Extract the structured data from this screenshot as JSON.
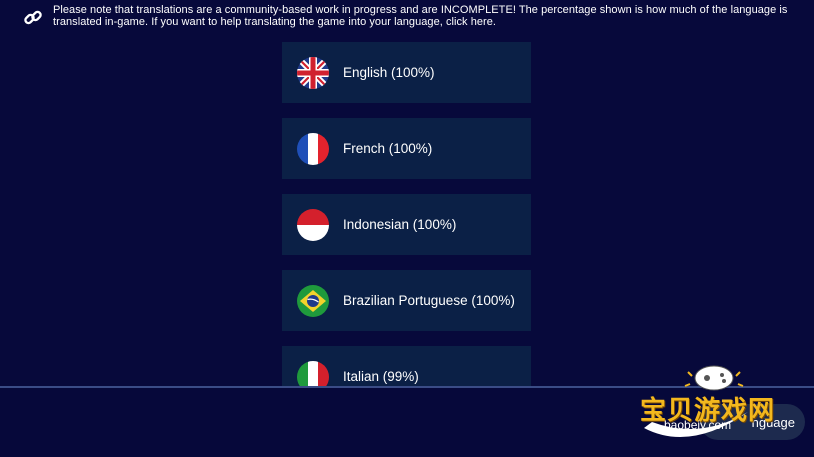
{
  "notice": {
    "text": "Please note that translations are a community-based work in progress and are INCOMPLETE! The percentage shown is how much of the language is translated in-game. If you want to help translating the game into your language, click here.",
    "icon": "link-icon"
  },
  "languages": [
    {
      "label": "English (100%)",
      "flag": "uk-flag-icon"
    },
    {
      "label": "French (100%)",
      "flag": "france-flag-icon"
    },
    {
      "label": "Indonesian (100%)",
      "flag": "indonesia-flag-icon"
    },
    {
      "label": "Brazilian Portuguese (100%)",
      "flag": "brazil-flag-icon"
    },
    {
      "label": "Italian (99%)",
      "flag": "italy-flag-icon"
    }
  ],
  "bottom": {
    "language_button_label": "nguage"
  },
  "watermark": {
    "cn": "宝贝游戏网",
    "en": "baobeiy.com"
  },
  "colors": {
    "background": "#07093b",
    "item_bg": "#0b2046",
    "divider": "#3a4c86",
    "watermark_gold": "#f3b81e"
  }
}
